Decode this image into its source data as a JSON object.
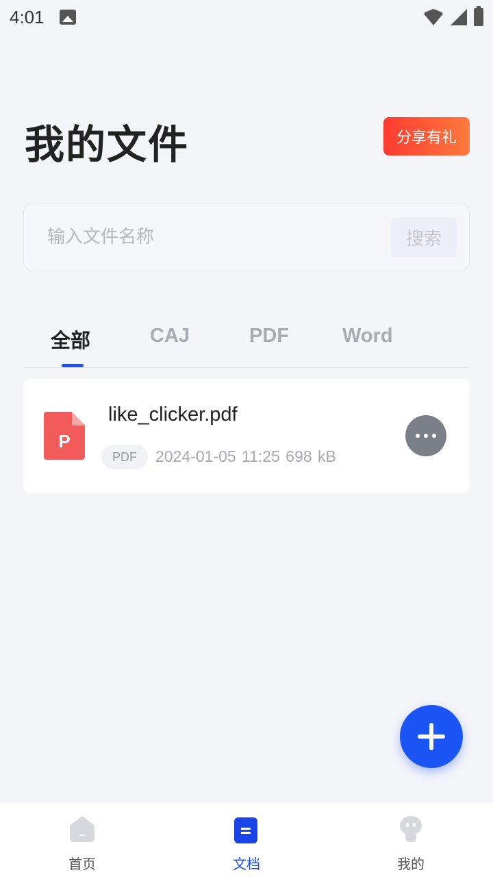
{
  "status_bar": {
    "time": "4:01",
    "icons": [
      "image-icon",
      "wifi-icon",
      "signal-icon",
      "battery-icon"
    ]
  },
  "header": {
    "title": "我的文件",
    "share_label": "分享有礼"
  },
  "search": {
    "placeholder": "输入文件名称",
    "value": "",
    "button_label": "搜索"
  },
  "tabs": [
    {
      "label": "全部",
      "active": true
    },
    {
      "label": "CAJ",
      "active": false
    },
    {
      "label": "PDF",
      "active": false
    },
    {
      "label": "Word",
      "active": false
    }
  ],
  "files": [
    {
      "icon_letter": "P",
      "name": "like_clicker.pdf",
      "type_tag": "PDF",
      "meta": "2024-01-05 11:25  698 kB"
    }
  ],
  "fab": {
    "icon": "plus-icon"
  },
  "bottom_nav": [
    {
      "label": "首页",
      "icon": "home-icon",
      "active": false
    },
    {
      "label": "文档",
      "icon": "document-icon",
      "active": true
    },
    {
      "label": "我的",
      "icon": "profile-icon",
      "active": false
    }
  ],
  "colors": {
    "accent": "#1b4fe8",
    "fab": "#1b55f5",
    "share_gradient_start": "#ff3b30",
    "share_gradient_end": "#ff7a3d",
    "pdf_icon": "#f35b5b"
  }
}
